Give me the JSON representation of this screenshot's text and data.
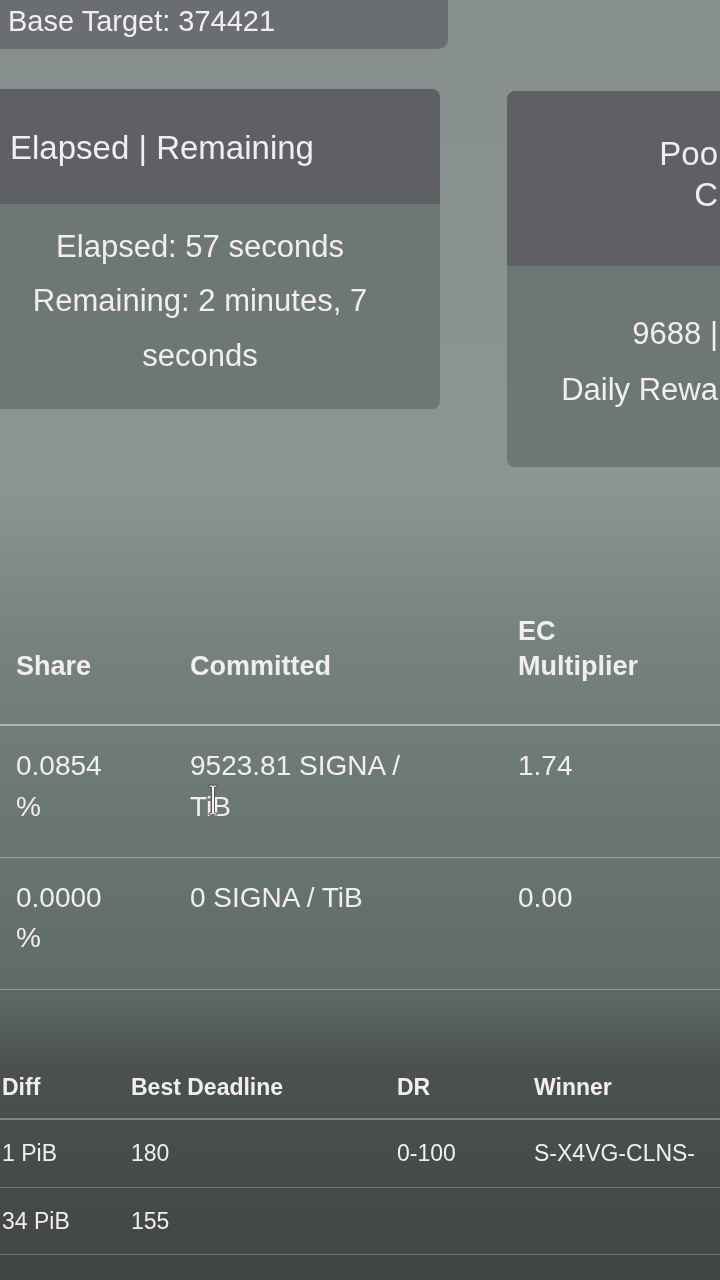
{
  "top_card": {
    "text": "Base Target: 374421"
  },
  "cards": [
    {
      "header": [
        "Elapsed | Remaining"
      ],
      "body": [
        "Elapsed: 57 seconds",
        "Remaining: 2 minutes, 7 seconds"
      ]
    },
    {
      "header": [
        "Poo",
        "C"
      ],
      "body": [
        "9688 |",
        "Daily Rewa"
      ]
    }
  ],
  "share_table": {
    "columns": [
      "Share",
      "Committed",
      "EC Multiplier"
    ],
    "rows": [
      [
        "0.0854 %",
        "9523.81 SIGNA / TiB",
        "1.74"
      ],
      [
        "0.0000 %",
        "0 SIGNA / TiB",
        "0.00"
      ]
    ]
  },
  "blocks_table": {
    "columns": [
      "Diff",
      "Best Deadline",
      "DR",
      "Winner"
    ],
    "rows": [
      [
        "1 PiB",
        "180",
        "0-100",
        "S-X4VG-CLNS-"
      ],
      [
        "34 PiB",
        "155"
      ]
    ]
  }
}
